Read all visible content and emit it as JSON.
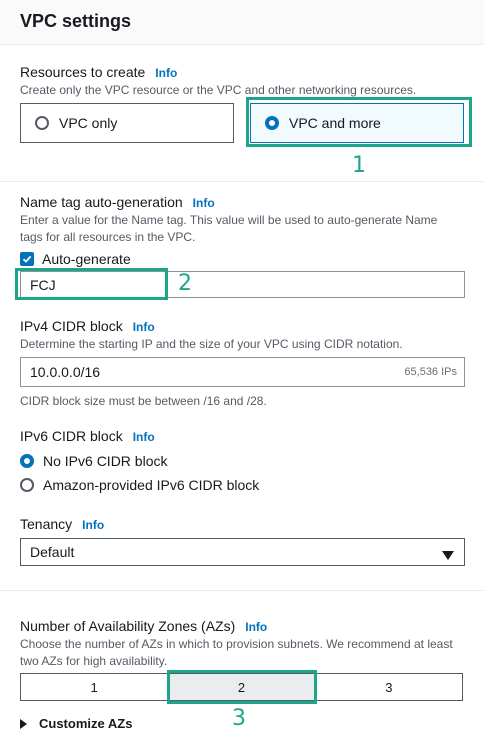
{
  "header": {
    "title": "VPC settings"
  },
  "resources": {
    "label": "Resources to create",
    "info": "Info",
    "description": "Create only the VPC resource or the VPC and other networking resources.",
    "options": [
      "VPC only",
      "VPC and more"
    ],
    "selected": "VPC and more"
  },
  "name_tag": {
    "label": "Name tag auto-generation",
    "info": "Info",
    "description_line1": "Enter a value for the Name tag. This value will be used to auto-generate Name",
    "description_line2": "tags for all resources in the VPC.",
    "checkbox_label": "Auto-generate",
    "checked": true,
    "value": "FCJ"
  },
  "ipv4": {
    "label": "IPv4 CIDR block",
    "info": "Info",
    "description": "Determine the starting IP and the size of your VPC using CIDR notation.",
    "value": "10.0.0.0/16",
    "suffix": "65,536 IPs",
    "hint": "CIDR block size must be between /16 and /28."
  },
  "ipv6": {
    "label": "IPv6 CIDR block",
    "info": "Info",
    "options": [
      "No IPv6 CIDR block",
      "Amazon-provided IPv6 CIDR block"
    ],
    "selected": "No IPv6 CIDR block"
  },
  "tenancy": {
    "label": "Tenancy",
    "info": "Info",
    "value": "Default"
  },
  "azs": {
    "label": "Number of Availability Zones (AZs)",
    "info": "Info",
    "description_line1": "Choose the number of AZs in which to provision subnets. We recommend at least",
    "description_line2": "two AZs for high availability.",
    "options": [
      "1",
      "2",
      "3"
    ],
    "selected": "2",
    "customize_label": "Customize AZs"
  },
  "annotations": {
    "a1": "1",
    "a2": "2",
    "a3": "3",
    "color": "#1ea589"
  },
  "colors": {
    "accent": "#0073bb",
    "annotation": "#1ea589"
  }
}
